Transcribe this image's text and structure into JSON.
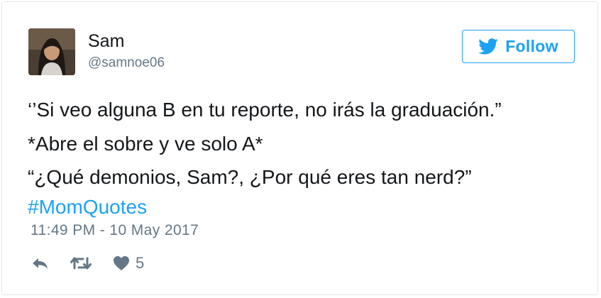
{
  "author": {
    "name": "Sam",
    "handle": "@samnoe06"
  },
  "follow_button": {
    "label": "Follow",
    "icon": "twitter-bird-icon"
  },
  "tweet": {
    "lines": [
      "‘’Si veo alguna B en tu reporte, no irás la graduación.”",
      "*Abre el sobre y ve solo A*",
      "“¿Qué demonios, Sam?, ¿Por qué eres tan nerd?”"
    ],
    "hashtag": "#MomQuotes",
    "timestamp": "11:49 PM - 10 May 2017"
  },
  "actions": {
    "reply_icon": "reply-icon",
    "retweet_icon": "retweet-icon",
    "like_icon": "heart-icon",
    "like_count": "5"
  },
  "colors": {
    "accent": "#1da1f2",
    "text": "#14171a",
    "muted": "#657786",
    "border": "#e1e8ed"
  }
}
